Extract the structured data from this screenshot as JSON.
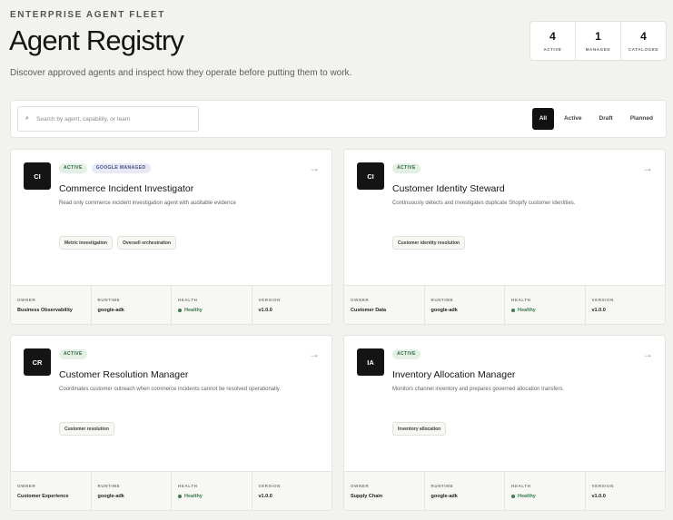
{
  "header": {
    "eyebrow": "ENTERPRISE AGENT FLEET",
    "title": "Agent Registry",
    "subtitle": "Discover approved agents and inspect how they operate before putting them to work."
  },
  "stats": [
    {
      "value": "4",
      "label": "ACTIVE"
    },
    {
      "value": "1",
      "label": "MANAGED"
    },
    {
      "value": "4",
      "label": "CATALOGED"
    }
  ],
  "search": {
    "placeholder": "Search by agent, capability, or team",
    "value": "",
    "icon": "search-icon"
  },
  "filters": [
    {
      "label": "All",
      "selected": true
    },
    {
      "label": "Active",
      "selected": false
    },
    {
      "label": "Draft",
      "selected": false
    },
    {
      "label": "Planned",
      "selected": false
    }
  ],
  "meta_labels": {
    "owner": "OWNER",
    "runtime": "RUNTIME",
    "health": "HEALTH",
    "version": "VERSION"
  },
  "agents": [
    {
      "initials": "CI",
      "status": "ACTIVE",
      "managed_badge": "GOOGLE MANAGED",
      "name": "Commerce Incident Investigator",
      "description": "Read only commerce incident investigation agent with auditable evidence",
      "tags": [
        "Metric investigation",
        "Oversell orchestration"
      ],
      "owner": "Business Observability",
      "runtime": "google-adk",
      "health": "Healthy",
      "version": "v1.0.0"
    },
    {
      "initials": "CI",
      "status": "ACTIVE",
      "name": "Customer Identity Steward",
      "description": "Continuously detects and investigates duplicate Shopify customer identities.",
      "tags": [
        "Customer identity resolution"
      ],
      "owner": "Customer Data",
      "runtime": "google-adk",
      "health": "Healthy",
      "version": "v1.0.0"
    },
    {
      "initials": "CR",
      "status": "ACTIVE",
      "name": "Customer Resolution Manager",
      "description": "Coordinates customer outreach when commerce incidents cannot be resolved operationally.",
      "tags": [
        "Customer resolution"
      ],
      "owner": "Customer Experience",
      "runtime": "google-adk",
      "health": "Healthy",
      "version": "v1.0.0"
    },
    {
      "initials": "IA",
      "status": "ACTIVE",
      "name": "Inventory Allocation Manager",
      "description": "Monitors channel inventory and prepares governed allocation transfers.",
      "tags": [
        "Inventory allocation"
      ],
      "owner": "Supply Chain",
      "runtime": "google-adk",
      "health": "Healthy",
      "version": "v1.0.0"
    }
  ],
  "colors": {
    "background": "#f2f2ee",
    "accent": "#111111",
    "healthy": "#3b7a4b",
    "active_badge": "#e4efe6",
    "managed_badge": "#e7e9f7"
  }
}
